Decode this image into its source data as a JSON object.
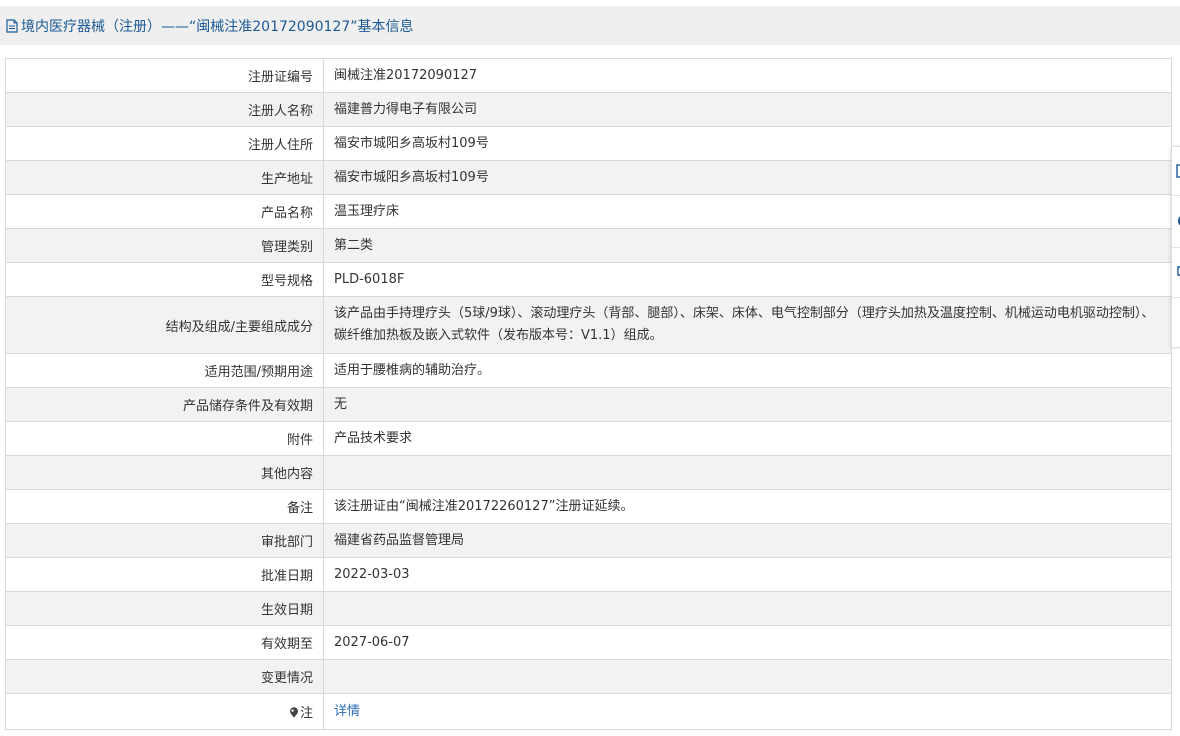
{
  "header": {
    "title": "境内医疗器械（注册）——“闽械注准20172090127”基本信息"
  },
  "rows": [
    {
      "label": "注册证编号",
      "value": "闽械注准20172090127"
    },
    {
      "label": "注册人名称",
      "value": "福建普力得电子有限公司"
    },
    {
      "label": "注册人住所",
      "value": "福安市城阳乡高坂村109号"
    },
    {
      "label": "生产地址",
      "value": "福安市城阳乡高坂村109号"
    },
    {
      "label": "产品名称",
      "value": "温玉理疗床"
    },
    {
      "label": "管理类别",
      "value": "第二类"
    },
    {
      "label": "型号规格",
      "value": "PLD-6018F"
    },
    {
      "label": "结构及组成/主要组成成分",
      "value": "该产品由手持理疗头（5球/9球）、滚动理疗头（背部、腿部）、床架、床体、电气控制部分（理疗头加热及温度控制、机械运动电机驱动控制）、碳纤维加热板及嵌入式软件（发布版本号：V1.1）组成。"
    },
    {
      "label": "适用范围/预期用途",
      "value": "适用于腰椎病的辅助治疗。"
    },
    {
      "label": "产品储存条件及有效期",
      "value": "无"
    },
    {
      "label": "附件",
      "value": "产品技术要求"
    },
    {
      "label": "其他内容",
      "value": ""
    },
    {
      "label": "备注",
      "value": "该注册证由“闽械注准20172260127”注册证延续。"
    },
    {
      "label": "审批部门",
      "value": "福建省药品监督管理局"
    },
    {
      "label": "批准日期",
      "value": "2022-03-03"
    },
    {
      "label": "生效日期",
      "value": ""
    },
    {
      "label": "有效期至",
      "value": "2027-06-07"
    },
    {
      "label": "变更情况",
      "value": ""
    }
  ],
  "note_row": {
    "label": "注",
    "link_text": "详情",
    "icon": "map-pin-icon"
  },
  "colors": {
    "title": "#1b5a96",
    "link": "#2a6db3",
    "alt_row": "#f2f2f2",
    "border": "#d9d9d9",
    "title_bar": "#efefef"
  }
}
